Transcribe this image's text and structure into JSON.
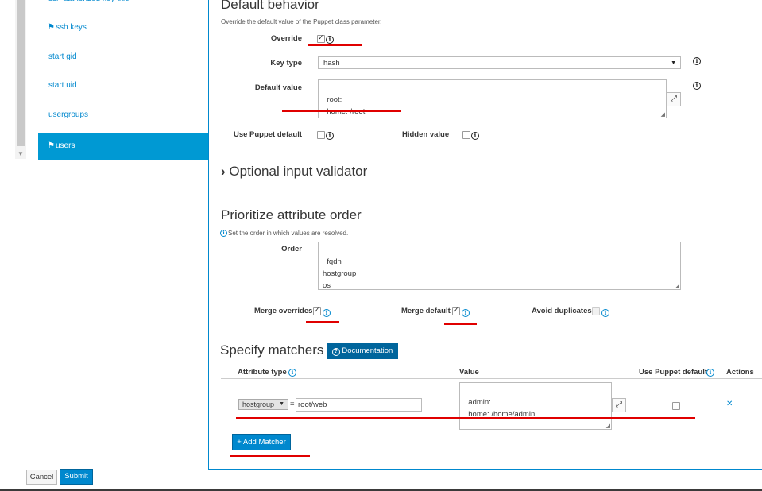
{
  "sidebar": {
    "items": [
      {
        "label": "ssh authorized key title",
        "flag": false,
        "active": false
      },
      {
        "label": "ssh keys",
        "flag": true,
        "active": false
      },
      {
        "label": "start gid",
        "flag": false,
        "active": false
      },
      {
        "label": "start uid",
        "flag": false,
        "active": false
      },
      {
        "label": "usergroups",
        "flag": false,
        "active": false
      },
      {
        "label": "users",
        "flag": true,
        "active": true
      }
    ]
  },
  "default_behavior": {
    "title": "Default behavior",
    "help": "Override the default value of the Puppet class parameter.",
    "override_label": "Override",
    "override_checked": true,
    "key_type_label": "Key type",
    "key_type_value": "hash",
    "default_value_label": "Default value",
    "default_value": "root:\n  home: /root",
    "use_puppet_default_label": "Use Puppet default",
    "hidden_value_label": "Hidden value"
  },
  "validator": {
    "chevron": "›",
    "title": "Optional input validator"
  },
  "prioritize": {
    "title": "Prioritize attribute order",
    "help": "Set the order in which values are resolved.",
    "order_label": "Order",
    "order_value": "fqdn\nhostgroup\nos\ndomain",
    "merge_overrides_label": "Merge overrides",
    "merge_overrides_checked": true,
    "merge_default_label": "Merge default",
    "merge_default_checked": true,
    "avoid_duplicates_label": "Avoid duplicates",
    "avoid_duplicates_checked": false
  },
  "matchers": {
    "title": "Specify matchers",
    "doc_button": "Documentation",
    "columns": {
      "attribute_type": "Attribute type",
      "value": "Value",
      "use_puppet_default": "Use Puppet default",
      "actions": "Actions"
    },
    "row": {
      "attribute": "hostgroup",
      "equals": "=",
      "match_value": "root/web",
      "value": "admin:\n  home: /home/admin",
      "remove": "✕"
    },
    "add_button": "+ Add Matcher"
  },
  "footer": {
    "cancel": "Cancel",
    "submit": "Submit"
  },
  "colors": {
    "accent": "#0088ce",
    "active_bg": "#0099d3",
    "annotation": "#e00000"
  }
}
